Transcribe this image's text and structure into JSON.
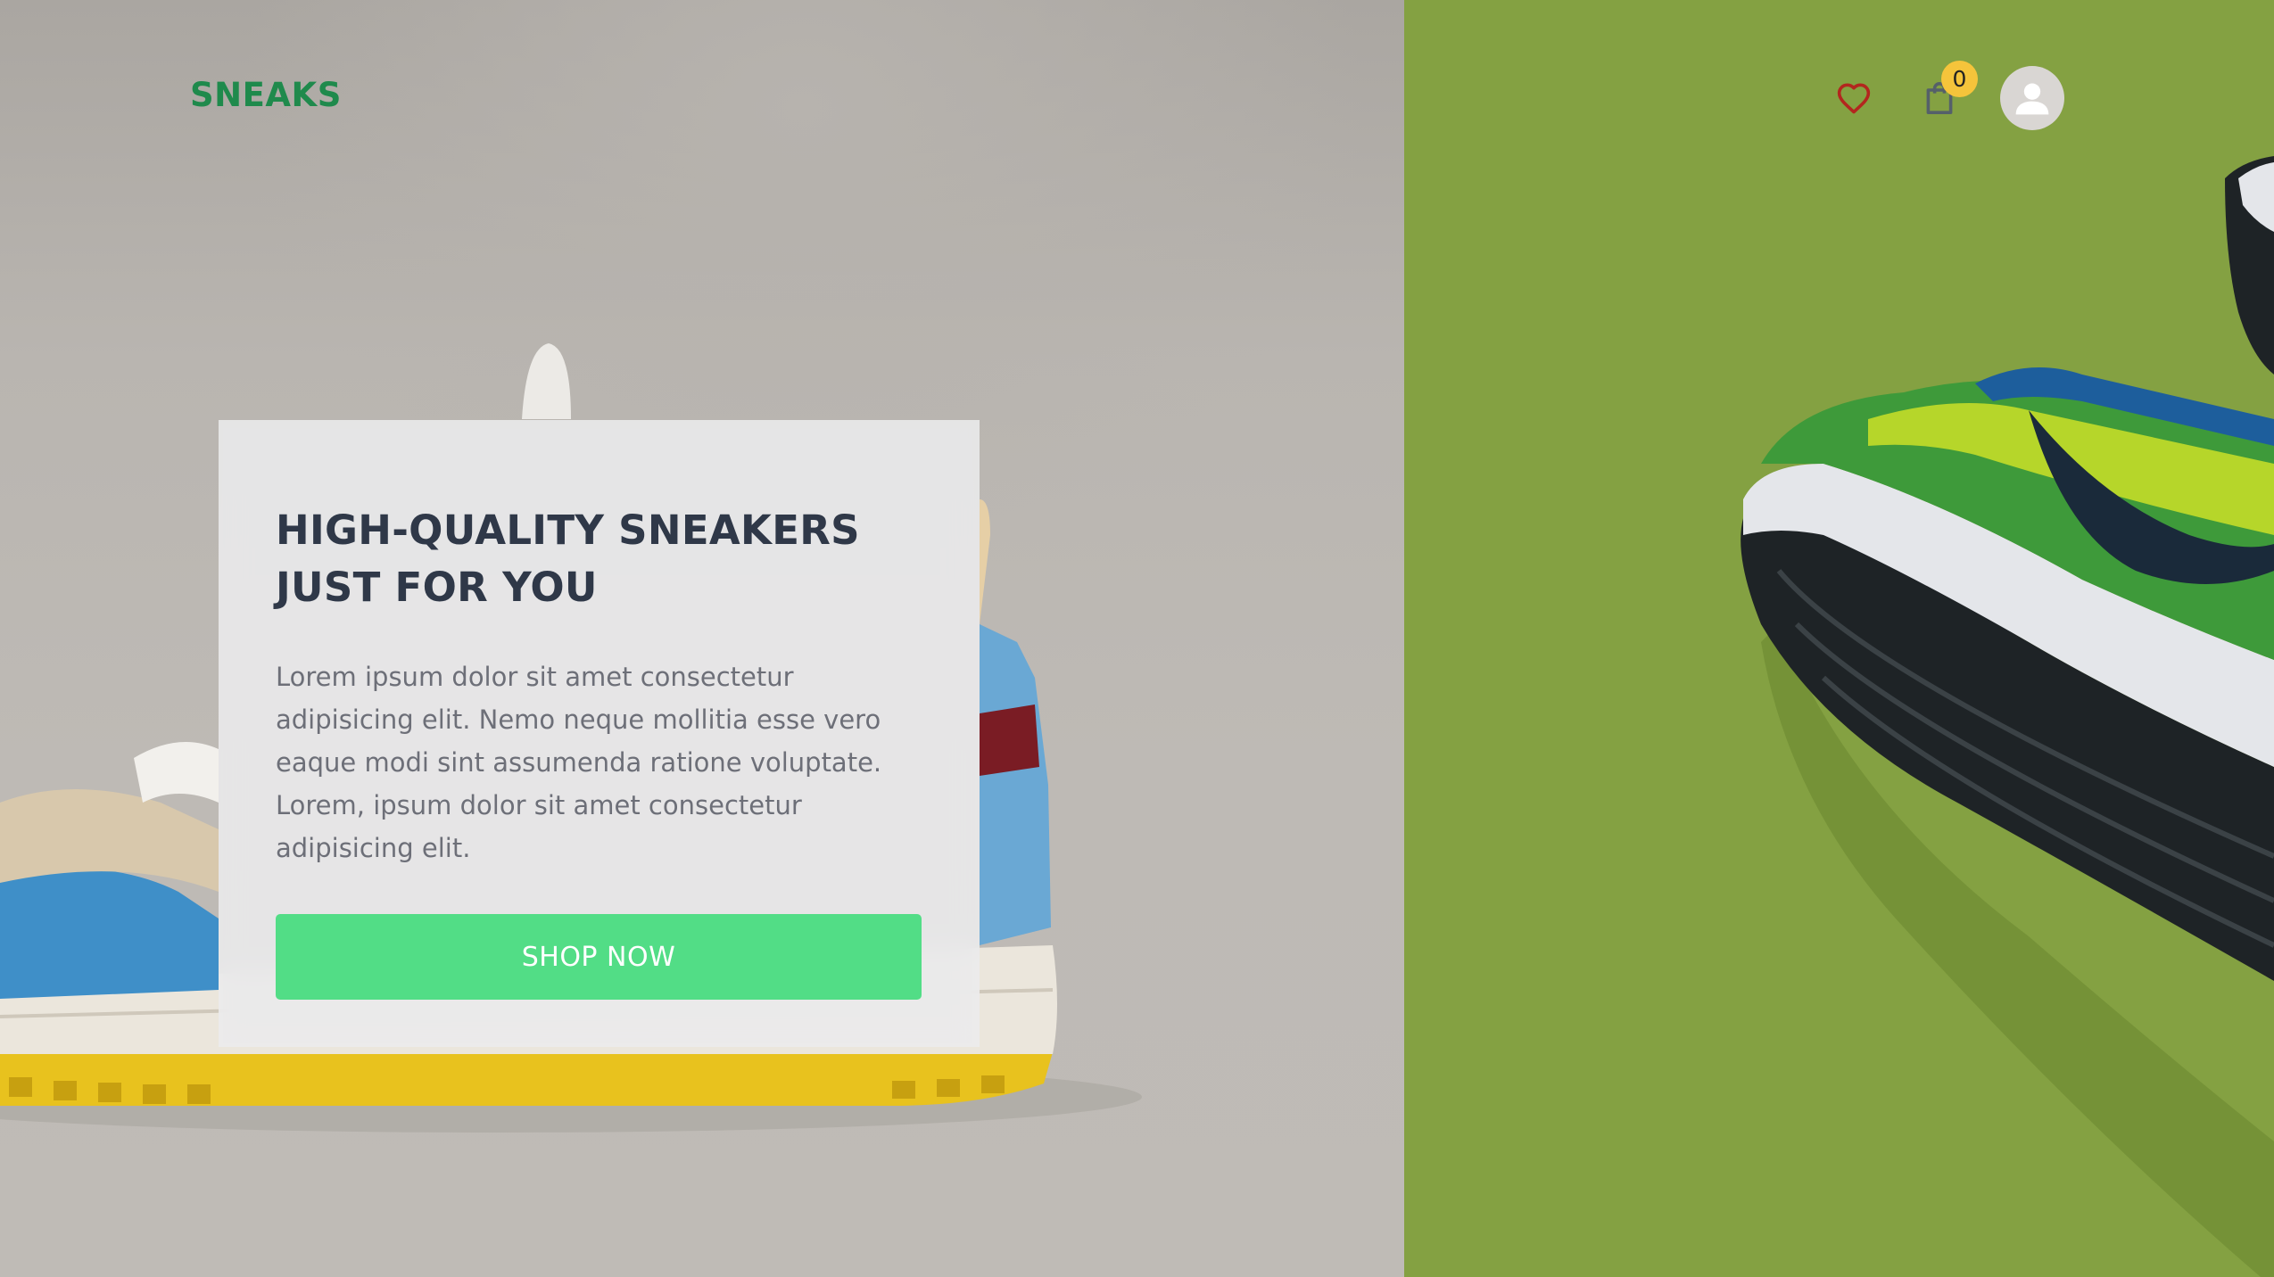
{
  "brand": {
    "logo_text": "SNEAKS",
    "logo_color": "#1f8a4c"
  },
  "header": {
    "wishlist_icon": "heart-icon",
    "cart_icon": "shopping-bag-icon",
    "cart_count": "0",
    "account_icon": "user-avatar-icon"
  },
  "hero": {
    "title_line1": "HIGH-QUALITY SNEAKERS",
    "title_line2": "JUST FOR YOU",
    "description": "Lorem ipsum dolor sit amet consectetur adipisicing elit. Nemo neque mollitia esse vero eaque modi sint assumenda ratione voluptate. Lorem, ipsum dolor sit amet consectetur adipisicing elit.",
    "cta_label": "SHOP NOW",
    "cta_color": "#52dd86"
  },
  "colors": {
    "left_panel_bg": "#b4b0aa",
    "right_panel_bg": "#84a142",
    "heart_color": "#b3261e",
    "badge_color": "#f5c43b",
    "title_color": "#2f3848"
  }
}
